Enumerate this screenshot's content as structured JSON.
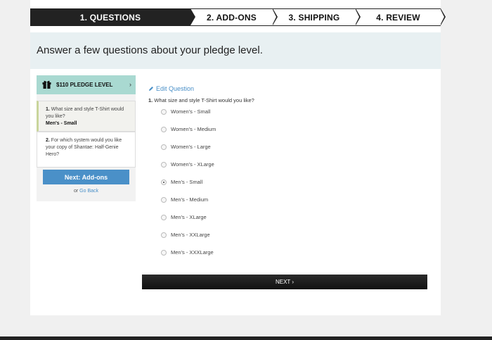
{
  "steps": [
    {
      "label": "1. QUESTIONS"
    },
    {
      "label": "2. ADD-ONS"
    },
    {
      "label": "3. SHIPPING"
    },
    {
      "label": "4. REVIEW"
    }
  ],
  "header": {
    "title": "Answer a few questions about your pledge level."
  },
  "sidebar": {
    "pledge_label": "$110 PLEDGE LEVEL",
    "chevron": "›",
    "questions": [
      {
        "num": "1.",
        "text": "What size and style T-Shirt would you like?",
        "answer": "Men's - Small"
      },
      {
        "num": "2.",
        "text": "For which system would you like your copy of Shantae: Half-Genie Hero?"
      }
    ],
    "next_button": "Next: Add-ons",
    "or_text": "or",
    "go_back": "Go Back"
  },
  "main": {
    "edit_label": "Edit Question",
    "question_num": "1.",
    "question_text": "What size and style T-Shirt would you like?",
    "options": [
      {
        "label": "Women's - Small",
        "checked": false
      },
      {
        "label": "Women's - Medium",
        "checked": false
      },
      {
        "label": "Women's - Large",
        "checked": false
      },
      {
        "label": "Women's - XLarge",
        "checked": false
      },
      {
        "label": "Men's - Small",
        "checked": true
      },
      {
        "label": "Men's - Medium",
        "checked": false
      },
      {
        "label": "Men's - XLarge",
        "checked": false
      },
      {
        "label": "Men's - XXLarge",
        "checked": false
      },
      {
        "label": "Men's - XXXLarge",
        "checked": false
      }
    ],
    "next_label": "NEXT ›"
  },
  "colors": {
    "accent": "#4a90c8",
    "pledge_bg": "#a9d9d1",
    "header_bg": "#e8f0f2",
    "dark": "#222222"
  },
  "icons": {
    "gift": "gift-icon",
    "pencil": "pencil-icon",
    "chevron": "chevron-right-icon"
  }
}
